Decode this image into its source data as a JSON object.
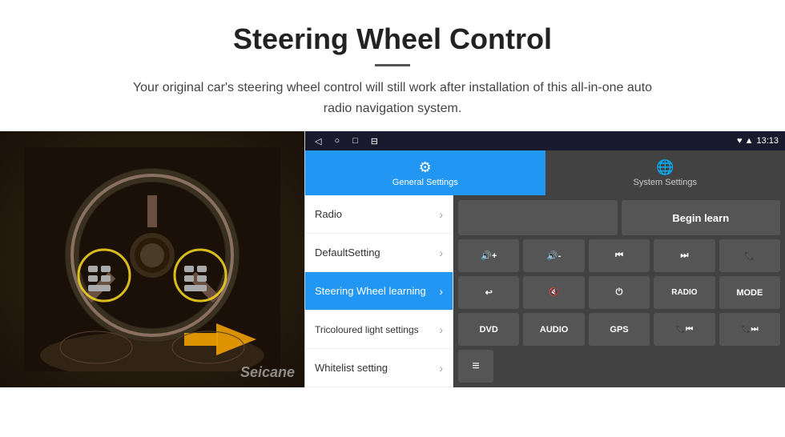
{
  "header": {
    "title": "Steering Wheel Control",
    "subtitle": "Your original car's steering wheel control will still work after installation of this all-in-one auto radio navigation system."
  },
  "watermark": "Seicane",
  "status_bar": {
    "time": "13:13",
    "nav_back": "◁",
    "nav_home": "○",
    "nav_square": "□",
    "nav_menu": "⊟"
  },
  "tabs": [
    {
      "label": "General Settings",
      "icon": "⚙",
      "active": true
    },
    {
      "label": "System Settings",
      "icon": "🌐",
      "active": false
    }
  ],
  "menu_items": [
    {
      "label": "Radio",
      "active": false
    },
    {
      "label": "DefaultSetting",
      "active": false
    },
    {
      "label": "Steering Wheel learning",
      "active": true
    },
    {
      "label": "Tricoloured light settings",
      "active": false
    },
    {
      "label": "Whitelist setting",
      "active": false
    }
  ],
  "right_panel": {
    "top_row": {
      "empty_label": "",
      "begin_learn_label": "Begin learn"
    },
    "row1": [
      "🔇+",
      "🔇-",
      "⏮",
      "⏭",
      "📞"
    ],
    "row2": [
      "↩",
      "🔇x",
      "⏻",
      "RADIO",
      "MODE"
    ],
    "row3": [
      "DVD",
      "AUDIO",
      "GPS",
      "📞⏮",
      "📞⏭"
    ],
    "row4": [
      "≡"
    ]
  }
}
